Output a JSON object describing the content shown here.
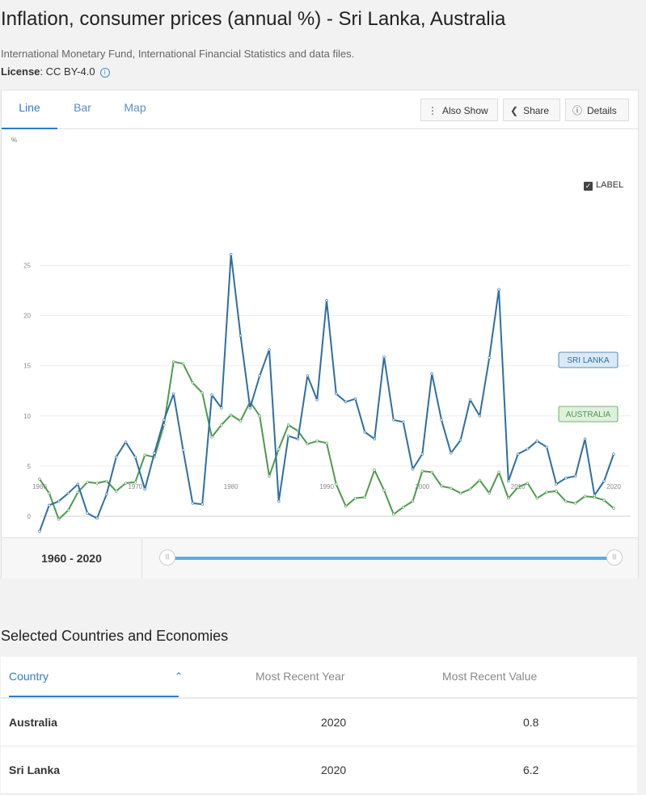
{
  "page": {
    "title": "Inflation, consumer prices (annual %) - Sri Lanka, Australia",
    "source": "International Monetary Fund, International Financial Statistics and data files.",
    "license_label": "License",
    "license_value": ": CC BY-4.0"
  },
  "tabs": [
    "Line",
    "Bar",
    "Map"
  ],
  "toolbar": {
    "also_show": "Also Show",
    "share": "Share",
    "details": "Details"
  },
  "chart_controls": {
    "label_toggle": "LABEL",
    "label_checked": true
  },
  "range": {
    "label": "1960 - 2020",
    "start": 1960,
    "end": 2020
  },
  "chart_data": {
    "type": "line",
    "ylabel": "%",
    "ylim": [
      -3,
      28
    ],
    "xlim": [
      1960,
      2020
    ],
    "yticks": [
      0,
      5,
      10,
      15,
      20,
      25
    ],
    "xticks": [
      1960,
      1970,
      1980,
      1990,
      2000,
      2010,
      2020
    ],
    "grid": "horizontal",
    "x": [
      1960,
      1961,
      1962,
      1963,
      1964,
      1965,
      1966,
      1967,
      1968,
      1969,
      1970,
      1971,
      1972,
      1973,
      1974,
      1975,
      1976,
      1977,
      1978,
      1979,
      1980,
      1981,
      1982,
      1983,
      1984,
      1985,
      1986,
      1987,
      1988,
      1989,
      1990,
      1991,
      1992,
      1993,
      1994,
      1995,
      1996,
      1997,
      1998,
      1999,
      2000,
      2001,
      2002,
      2003,
      2004,
      2005,
      2006,
      2007,
      2008,
      2009,
      2010,
      2011,
      2012,
      2013,
      2014,
      2015,
      2016,
      2017,
      2018,
      2019,
      2020
    ],
    "series": [
      {
        "name": "SRI LANKA",
        "color": "#2e6fa3",
        "label_bg": "#dbe9f6",
        "values": [
          -1.5,
          1.1,
          1.5,
          2.3,
          3.2,
          0.3,
          -0.2,
          2.2,
          5.9,
          7.4,
          5.9,
          2.7,
          6.3,
          9.6,
          12.2,
          6.6,
          1.3,
          1.2,
          12.1,
          10.8,
          26.1,
          18.0,
          10.8,
          14.0,
          16.6,
          1.5,
          8.0,
          7.7,
          14.0,
          11.6,
          21.5,
          12.2,
          11.4,
          11.7,
          8.4,
          7.7,
          15.9,
          9.6,
          9.4,
          4.7,
          6.2,
          14.2,
          9.6,
          6.3,
          7.6,
          11.6,
          10.0,
          15.8,
          22.6,
          3.5,
          6.2,
          6.7,
          7.5,
          6.9,
          3.2,
          3.8,
          4.0,
          7.7,
          2.1,
          3.5,
          6.2
        ]
      },
      {
        "name": "AUSTRALIA",
        "color": "#4e9a4e",
        "label_bg": "#dff0dc",
        "values": [
          3.7,
          2.3,
          -0.3,
          0.6,
          2.4,
          3.4,
          3.3,
          3.5,
          2.5,
          3.3,
          3.4,
          6.1,
          5.9,
          9.1,
          15.4,
          15.2,
          13.3,
          12.3,
          7.9,
          9.1,
          10.1,
          9.5,
          11.4,
          10.0,
          4.0,
          6.7,
          9.1,
          8.5,
          7.2,
          7.5,
          7.3,
          3.2,
          1.0,
          1.8,
          1.9,
          4.6,
          2.6,
          0.2,
          0.9,
          1.5,
          4.5,
          4.4,
          3.0,
          2.8,
          2.3,
          2.7,
          3.6,
          2.3,
          4.4,
          1.8,
          2.9,
          3.3,
          1.8,
          2.4,
          2.5,
          1.5,
          1.3,
          2.0,
          1.9,
          1.6,
          0.8
        ]
      }
    ]
  },
  "table": {
    "title": "Selected Countries and Economies",
    "headers": [
      "Country",
      "Most Recent Year",
      "Most Recent Value"
    ],
    "rows": [
      {
        "country": "Australia",
        "year": "2020",
        "value": "0.8"
      },
      {
        "country": "Sri Lanka",
        "year": "2020",
        "value": "6.2"
      }
    ]
  }
}
